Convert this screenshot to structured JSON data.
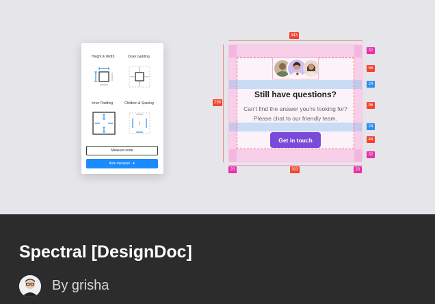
{
  "plugin_panel": {
    "options": [
      {
        "label": "Height & Width",
        "icon": "height-width-icon"
      },
      {
        "label": "Outer padding",
        "icon": "outer-padding-icon"
      },
      {
        "label": "Inner Padding",
        "icon": "inner-padding-icon"
      },
      {
        "label": "Children & Spacing",
        "icon": "children-spacing-icon"
      }
    ],
    "measure_node_label": "Measure node",
    "auto_measure_label": "Auto measure",
    "auto_measure_icon": "sparkle-icon",
    "accent_color": "#1b8cff"
  },
  "spec_card": {
    "title": "Still have questions?",
    "description": "Can’t find the answer you’re looking for? Please chat to our friendly team.",
    "button_label": "Get in touch",
    "button_color": "#7c4ad8",
    "measurements": {
      "width": "343",
      "height": "298",
      "padding_top": "32",
      "avatar_height": "56",
      "gap_top": "24",
      "text_height": "96",
      "gap_bottom": "24",
      "button_height": "44",
      "padding_bottom": "32",
      "padding_left": "20",
      "inner_width": "303",
      "padding_right": "20"
    },
    "badge_colors": {
      "size": "#f2442e",
      "padding": "#ea2ea8",
      "spacing": "#2d8ff0"
    }
  },
  "file": {
    "title": "Spectral [DesignDoc]",
    "byline": "By grisha",
    "avatar_icon": "user-avatar-icon"
  }
}
